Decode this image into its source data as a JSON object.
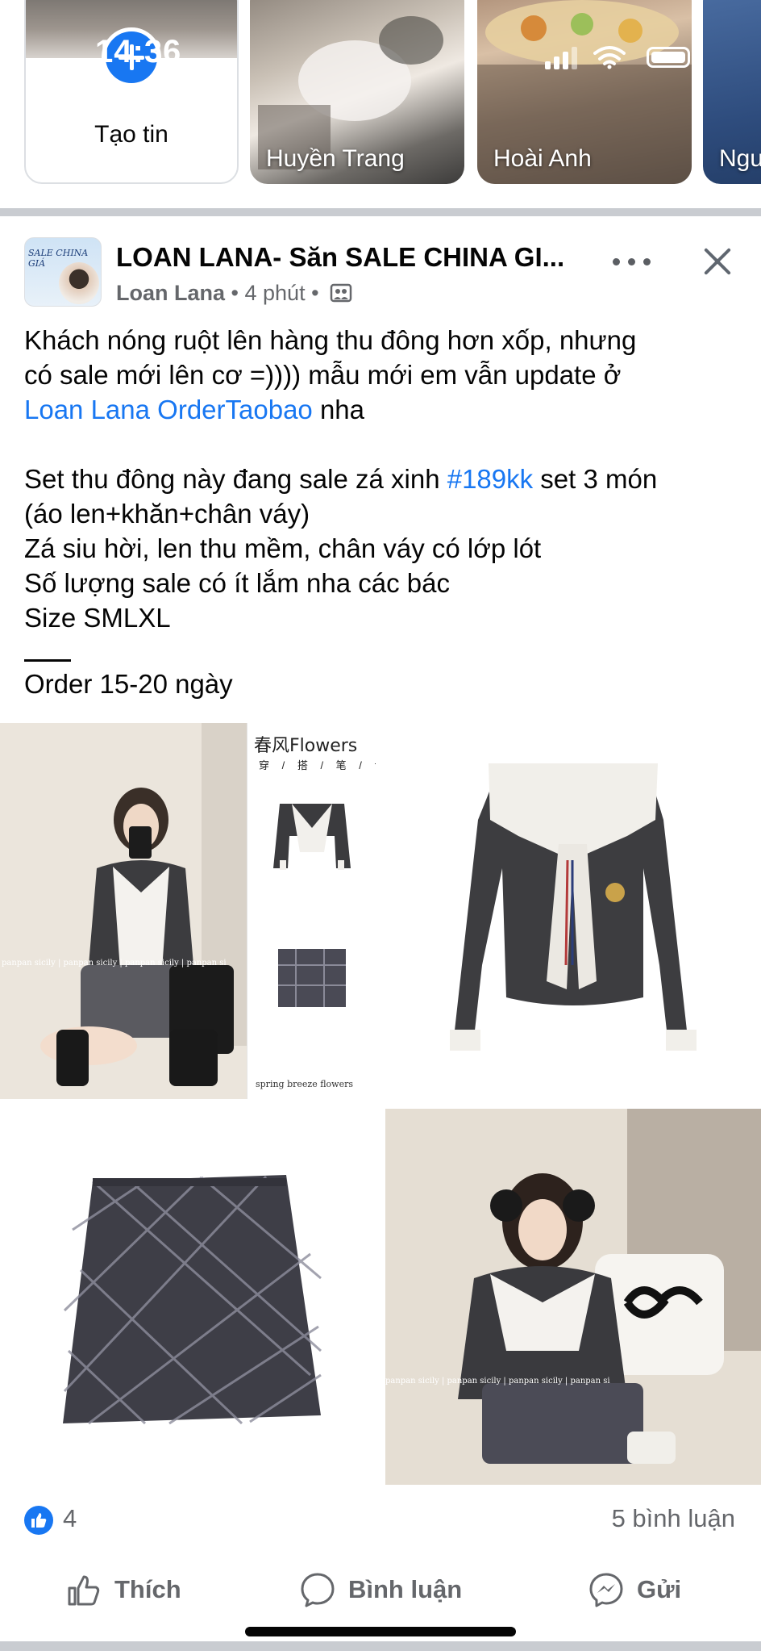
{
  "status_bar": {
    "time": "14:36"
  },
  "stories": {
    "create_label": "Tạo tin",
    "items": [
      {
        "name": "Huyền Trang"
      },
      {
        "name": "Hoài Anh"
      },
      {
        "name": "Ngu"
      }
    ]
  },
  "post": {
    "page_name": "LOAN LANA- Săn SALE CHINA GI...",
    "avatar_text": "SALE CHINA GIÁ",
    "author": "Loan Lana",
    "time": "4 phút",
    "separator": "•",
    "text": {
      "line1": "Khách nóng ruột lên hàng thu đông hơn xốp, nhưng",
      "line2": "có sale mới lên cơ =)))) mẫu mới em vẫn update ở",
      "line3_link": "Loan Lana OrderTaobao",
      "line3_rest": " nha",
      "line4_a": "Set thu đông này đang sale zá xinh ",
      "line4_hashtag": "#189kk",
      "line4_b": " set 3 món",
      "line5": "(áo len+khăn+chân váy)",
      "line6": "Zá siu hời, len thu mềm, chân váy có lớp lót",
      "line7": "Số lượng sale có ít lắm nha các bác",
      "line8": "Size SMLXL",
      "line9": "Order 15-20 ngày"
    },
    "photos": {
      "brand_title": "春风Flowers",
      "brand_subtitle": "穿 / 搭 / 笔 / 记",
      "brand_footer": "spring breeze flowers",
      "watermark": "panpan sicily | panpan sicily | panpan sicily | panpan si"
    },
    "stats": {
      "likes": "4",
      "comments": "5 bình luận"
    },
    "actions": {
      "like": "Thích",
      "comment": "Bình luận",
      "share": "Gửi"
    }
  },
  "colors": {
    "accent": "#1877f2",
    "secondary_text": "#65676b",
    "divider": "#c9ccd1"
  }
}
